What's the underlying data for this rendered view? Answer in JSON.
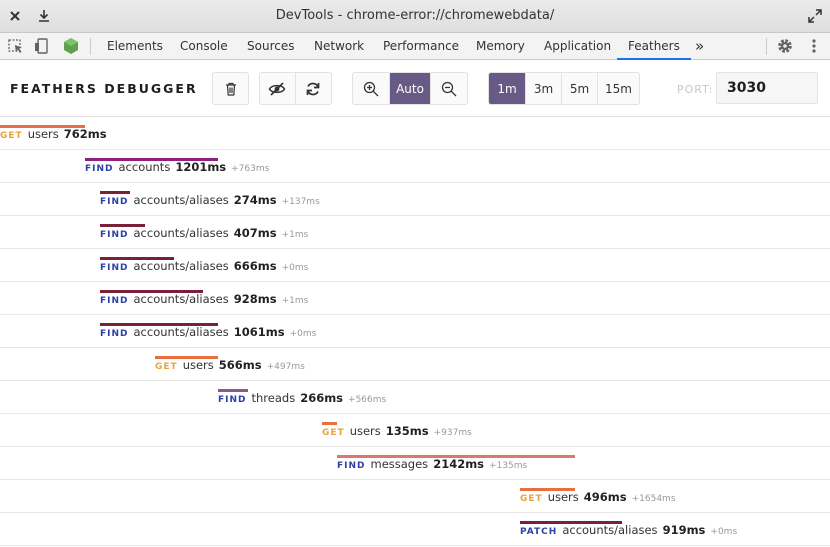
{
  "window": {
    "title": "DevTools - chrome-error://chromewebdata/"
  },
  "devtools": {
    "tabs": [
      {
        "label": "Elements"
      },
      {
        "label": "Console"
      },
      {
        "label": "Sources"
      },
      {
        "label": "Network"
      },
      {
        "label": "Performance"
      },
      {
        "label": "Memory"
      },
      {
        "label": "Application"
      },
      {
        "label": "Feathers",
        "active": true
      }
    ],
    "more_symbol": "»"
  },
  "toolbar": {
    "brand": "FEATHERS DEBUGGER",
    "zoom_auto_label": "Auto",
    "ranges": [
      "1m",
      "3m",
      "5m",
      "15m"
    ],
    "active_range": "1m",
    "port_label": "PORT:",
    "port_value": "3030"
  },
  "colors": {
    "accent": "#675a84",
    "tab_active": "#1a73e8",
    "get": "#e8a33b",
    "find": "#2d3fa6"
  },
  "requests": [
    {
      "method": "GET",
      "service": "users",
      "duration": "762ms",
      "delta": "",
      "bar_color": "#e8703f"
    },
    {
      "method": "FIND",
      "service": "accounts",
      "duration": "1201ms",
      "delta": "+763ms",
      "bar_color": "#8f1f7f"
    },
    {
      "method": "FIND",
      "service": "accounts/aliases",
      "duration": "274ms",
      "delta": "+137ms",
      "bar_color": "#7a2038"
    },
    {
      "method": "FIND",
      "service": "accounts/aliases",
      "duration": "407ms",
      "delta": "+1ms",
      "bar_color": "#7a2038"
    },
    {
      "method": "FIND",
      "service": "accounts/aliases",
      "duration": "666ms",
      "delta": "+0ms",
      "bar_color": "#7a2038"
    },
    {
      "method": "FIND",
      "service": "accounts/aliases",
      "duration": "928ms",
      "delta": "+1ms",
      "bar_color": "#7a2038"
    },
    {
      "method": "FIND",
      "service": "accounts/aliases",
      "duration": "1061ms",
      "delta": "+0ms",
      "bar_color": "#7a2038"
    },
    {
      "method": "GET",
      "service": "users",
      "duration": "566ms",
      "delta": "+497ms",
      "bar_color": "#e8703f"
    },
    {
      "method": "FIND",
      "service": "threads",
      "duration": "266ms",
      "delta": "+566ms",
      "bar_color": "#8a5a8f"
    },
    {
      "method": "GET",
      "service": "users",
      "duration": "135ms",
      "delta": "+937ms",
      "bar_color": "#e8703f"
    },
    {
      "method": "FIND",
      "service": "messages",
      "duration": "2142ms",
      "delta": "+135ms",
      "bar_color": "#d97a6e"
    },
    {
      "method": "GET",
      "service": "users",
      "duration": "496ms",
      "delta": "+1654ms",
      "bar_color": "#e8703f"
    },
    {
      "method": "PATCH",
      "service": "accounts/aliases",
      "duration": "919ms",
      "delta": "+0ms",
      "bar_color": "#7a2038"
    }
  ]
}
